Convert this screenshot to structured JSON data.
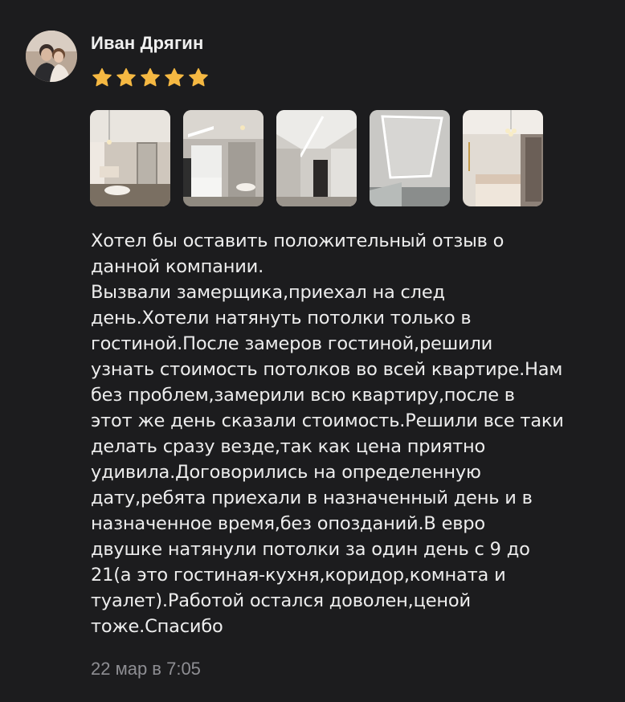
{
  "review": {
    "author": "Иван Дрягин",
    "rating": 5,
    "star_color": "#f5b842",
    "photos": [
      {
        "icon": "living-room-photo"
      },
      {
        "icon": "kitchen-photo"
      },
      {
        "icon": "corridor-photo"
      },
      {
        "icon": "ceiling-lighting-photo"
      },
      {
        "icon": "bedroom-photo"
      }
    ],
    "text": "Хотел бы оставить положительный отзыв о\nданной компании.\nВызвали замерщика,приехал на след\nдень.Хотели натянуть потолки только в\nгостиной.После замеров гостиной,решили\nузнать стоимость потолков во всей квартире.Нам\nбез проблем,замерили всю квартиру,после в\nэтот же день сказали стоимость.Решили все таки\nделать сразу везде,так как цена приятно\nудивила.Договорились на определенную\nдату,ребята приехали в назначенный день и в\nназначенное время,без опозданий.В евро\nдвушке натянули потолки за один день с 9 до\n21(а это гостиная-кухня,коридор,комната и\nтуалет).Работой остался доволен,ценой\nтоже.Спасибо",
    "date": "22 мар в 7:05"
  }
}
